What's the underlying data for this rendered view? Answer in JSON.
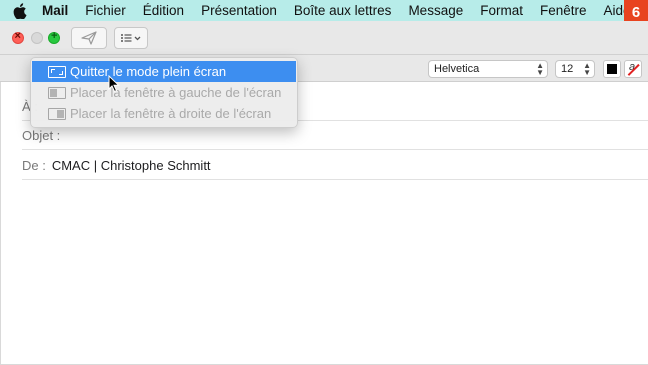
{
  "menubar": {
    "apple_icon": "apple-logo-icon",
    "app_name": "Mail",
    "items": [
      "Fichier",
      "Édition",
      "Présentation",
      "Boîte aux lettres",
      "Message",
      "Format",
      "Fenêtre",
      "Aide"
    ],
    "badge": "6",
    "background": "#b7ece9",
    "badge_color": "#e8431f"
  },
  "toolbar": {
    "send_icon": "paper-plane-icon",
    "header_fields_icon": "list-chevron-icon"
  },
  "format_bar": {
    "font": "Helvetica",
    "size": "12",
    "text_color": "#000000"
  },
  "compose": {
    "to_label": "À :",
    "subject_label": "Objet :",
    "from_label": "De :",
    "from_value": "CMAC | Christophe Schmitt"
  },
  "window_menu": {
    "items": [
      {
        "label": "Quitter le mode plein écran",
        "icon": "exit-fullscreen-icon",
        "enabled": true,
        "highlighted": true
      },
      {
        "label": "Placer la fenêtre à gauche de l'écran",
        "icon": "tile-left-icon",
        "enabled": false,
        "highlighted": false
      },
      {
        "label": "Placer la fenêtre à droite de l'écran",
        "icon": "tile-right-icon",
        "enabled": false,
        "highlighted": false
      }
    ],
    "highlight_color": "#3d8ef0"
  }
}
